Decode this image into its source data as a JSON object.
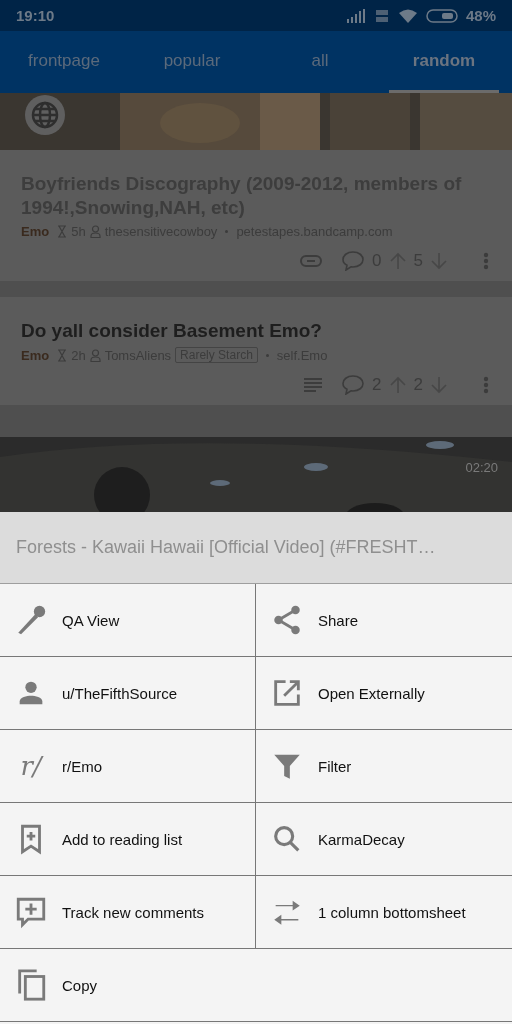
{
  "status_bar": {
    "time": "19:10",
    "battery": "48%"
  },
  "tabs": [
    {
      "label": "frontpage",
      "selected": false
    },
    {
      "label": "popular",
      "selected": false
    },
    {
      "label": "all",
      "selected": false
    },
    {
      "label": "random",
      "selected": true
    }
  ],
  "posts": [
    {
      "title": "Boyfriends Discography (2009-2012, members of 1994!,Snowing,NAH, etc)",
      "subreddit": "Emo",
      "age": "5h",
      "author": "thesensitivecowboy",
      "domain": "petestapes.bandcamp.com",
      "comments": "0",
      "score": "5"
    },
    {
      "title": "Do yall consider Basement Emo?",
      "subreddit": "Emo",
      "age": "2h",
      "author": "TomsAliens",
      "flair": "Rarely Starch",
      "domain": "self.Emo",
      "comments": "2",
      "score": "2"
    }
  ],
  "video": {
    "duration": "02:20"
  },
  "sheet": {
    "title": "Forests - Kawaii Hawaii [Official Video] (#FRESHT…",
    "items": [
      {
        "label": "QA View",
        "kind": "half"
      },
      {
        "label": "Share",
        "kind": "half"
      },
      {
        "label": "u/TheFifthSource",
        "kind": "half"
      },
      {
        "label": "Open Externally",
        "kind": "half"
      },
      {
        "label": "r/Emo",
        "kind": "half",
        "glyph": "r/"
      },
      {
        "label": "Filter",
        "kind": "half"
      },
      {
        "label": "Add to reading list",
        "kind": "half"
      },
      {
        "label": "KarmaDecay",
        "kind": "half"
      },
      {
        "label": "Track new comments",
        "kind": "half"
      },
      {
        "label": "1 column bottomsheet",
        "kind": "half"
      },
      {
        "label": "Copy",
        "kind": "full"
      }
    ]
  }
}
